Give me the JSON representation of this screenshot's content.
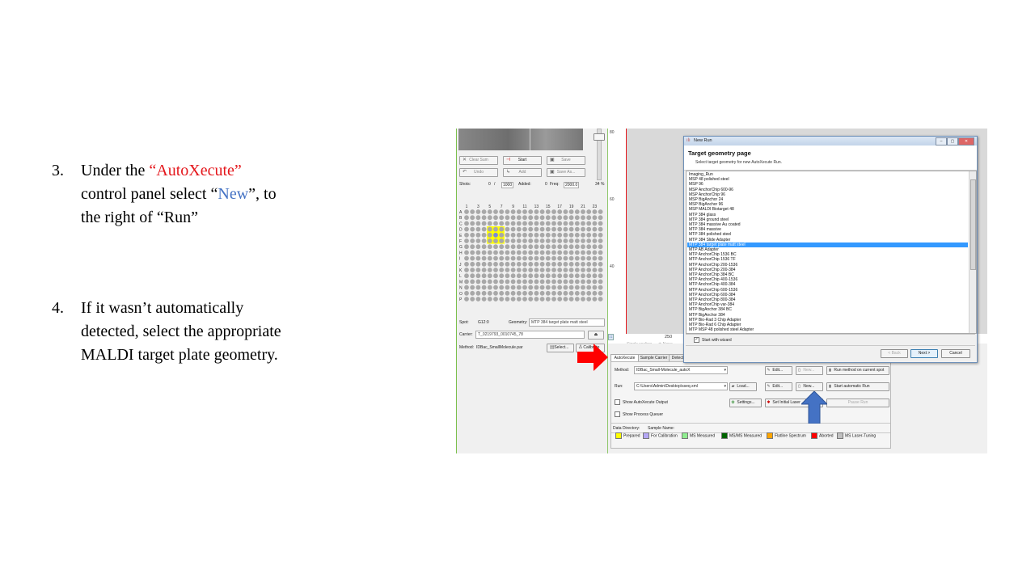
{
  "slide": {
    "step3": {
      "number": "3.",
      "before": "Under the ",
      "highlight_autoxecute": "“AutoXecute”",
      "line2_a": "control panel select “",
      "highlight_new": "New",
      "line2_b": "”, to",
      "line3": "the right  of “Run”"
    },
    "step4": {
      "number": "4.",
      "line1": "If it wasn’t automatically",
      "line2": "detected, select the appropriate",
      "line3": "MALDI target plate geometry."
    },
    "colors": {
      "red": "#e4161b",
      "blue": "#4472c4"
    }
  },
  "left_panel": {
    "buttons": {
      "clear_sum": "Clear Sum",
      "start": "Start",
      "save": "Save",
      "undo": "Undo",
      "add": "Add",
      "save_as": "Save As..."
    },
    "shots_label": "Shots:",
    "shots_value": "0",
    "shots_sep": "/",
    "shots_total": "1000",
    "added_label": "Added:",
    "added_value": "0",
    "freq_label": "Freq:",
    "freq_value": "2000.0",
    "percent": "34 %",
    "col_labels": [
      "1",
      "3",
      "5",
      "7",
      "9",
      "11",
      "13",
      "15",
      "17",
      "19",
      "21",
      "23"
    ],
    "row_labels": [
      "A",
      "B",
      "C",
      "D",
      "E",
      "F",
      "G",
      "H",
      "I",
      "J",
      "K",
      "L",
      "M",
      "N",
      "O",
      "P"
    ],
    "spot_label": "Spot:",
    "spot_value": "G12:0",
    "geometry_label": "Geometry:",
    "geometry_value": "MTP 384 target plate matt steel",
    "carrier_label": "Carrier:",
    "carrier_value": "T_0219793_0010745_78",
    "method_label": "Method:",
    "method_value": "IDBac_SmallMolecule.par",
    "select_btn": "Select...",
    "calibrate_btn": "Calibrate"
  },
  "plot": {
    "y_ticks": [
      "80",
      "60",
      "40"
    ],
    "x_tick": "250",
    "single_scaling": "Single scaling",
    "none": "None"
  },
  "dialog": {
    "title": "New Run",
    "heading": "Target geometry page",
    "subheading": "Select target geometry for new AutoXecute Run.",
    "items": [
      "Imaging_Run",
      "MSP 48 polished steel",
      "MSP 96",
      "MSP AnchorChip 600-96",
      "MSP AnchorChip 96",
      "MSP BigAnchor 24",
      "MSP BigAnchor 96",
      "MSP MALDI Biotarget 48",
      "MTP 384 glass",
      "MTP 384 ground steel",
      "MTP 384 massive Au coated",
      "MTP 384 massive",
      "MTP 384 polished steel",
      "MTP 384 Slide Adapter",
      "MTP 384 target plate matt steel",
      "MTP AB Adapter",
      "MTP AnchorChip 1536 BC",
      "MTP AnchorChip 1536 TF",
      "MTP AnchorChip 200-1536",
      "MTP AnchorChip 200-384",
      "MTP AnchorChip 384 BC",
      "MTP AnchorChip 400-1536",
      "MTP AnchorChip 400-384",
      "MTP AnchorChip 600-1536",
      "MTP AnchorChip 600-384",
      "MTP AnchorChip 800-384",
      "MTP AnchorChip var-384",
      "MTP BigAnchor 384 BC",
      "MTP BigAnchor 384",
      "MTP Bio-Rad 3 Chip Adapter",
      "MTP Bio-Rad 6 Chip Adapter",
      "MTP MSP 48 polished steel Adapter"
    ],
    "selected_index": 14,
    "wizard_label": "Start with wizard",
    "back": "< Back",
    "next": "Next >",
    "cancel": "Cancel"
  },
  "autoxecute": {
    "tabs": [
      "AutoXecute",
      "Sample Carrier",
      "Detect"
    ],
    "method_label": "Method:",
    "method_value": "IDBac_Small-Molecule_autoX",
    "edit": "Edit...",
    "new": "New...",
    "run_method_current": "Run method on current spot",
    "run_label": "Run:",
    "run_value": "C:\\Users\\Admin\\Desktop\\sseq.xml",
    "load": "Load...",
    "start_automatic": "Start automatic Run",
    "show_output": "Show AutoXecute Output",
    "settings": "Settings...",
    "set_initial_laser": "Set Initial Laser",
    "pause_run": "Pause Run",
    "show_process_queuer": "Show Process Queuer",
    "data_directory": "Data Directory:",
    "sample_name": "Sample Name:"
  },
  "legend": [
    {
      "label": "Prepared",
      "color": "#ffff00"
    },
    {
      "label": "For Calibration",
      "color": "#b4a7f5"
    },
    {
      "label": "MS Measured",
      "color": "#90ee90"
    },
    {
      "label": "MS/MS Measured",
      "color": "#006400"
    },
    {
      "label": "Flatline Spectrum",
      "color": "#ffa500"
    },
    {
      "label": "Aborted",
      "color": "#ff0000"
    },
    {
      "label": "MS Laser-Tuning",
      "color": "#c0c0c0"
    }
  ],
  "annotations": {
    "red_arrow_icon": "arrow-right-icon",
    "blue_arrow_icon": "arrow-up-icon",
    "red": "#e4161b",
    "blue": "#4472c4"
  }
}
